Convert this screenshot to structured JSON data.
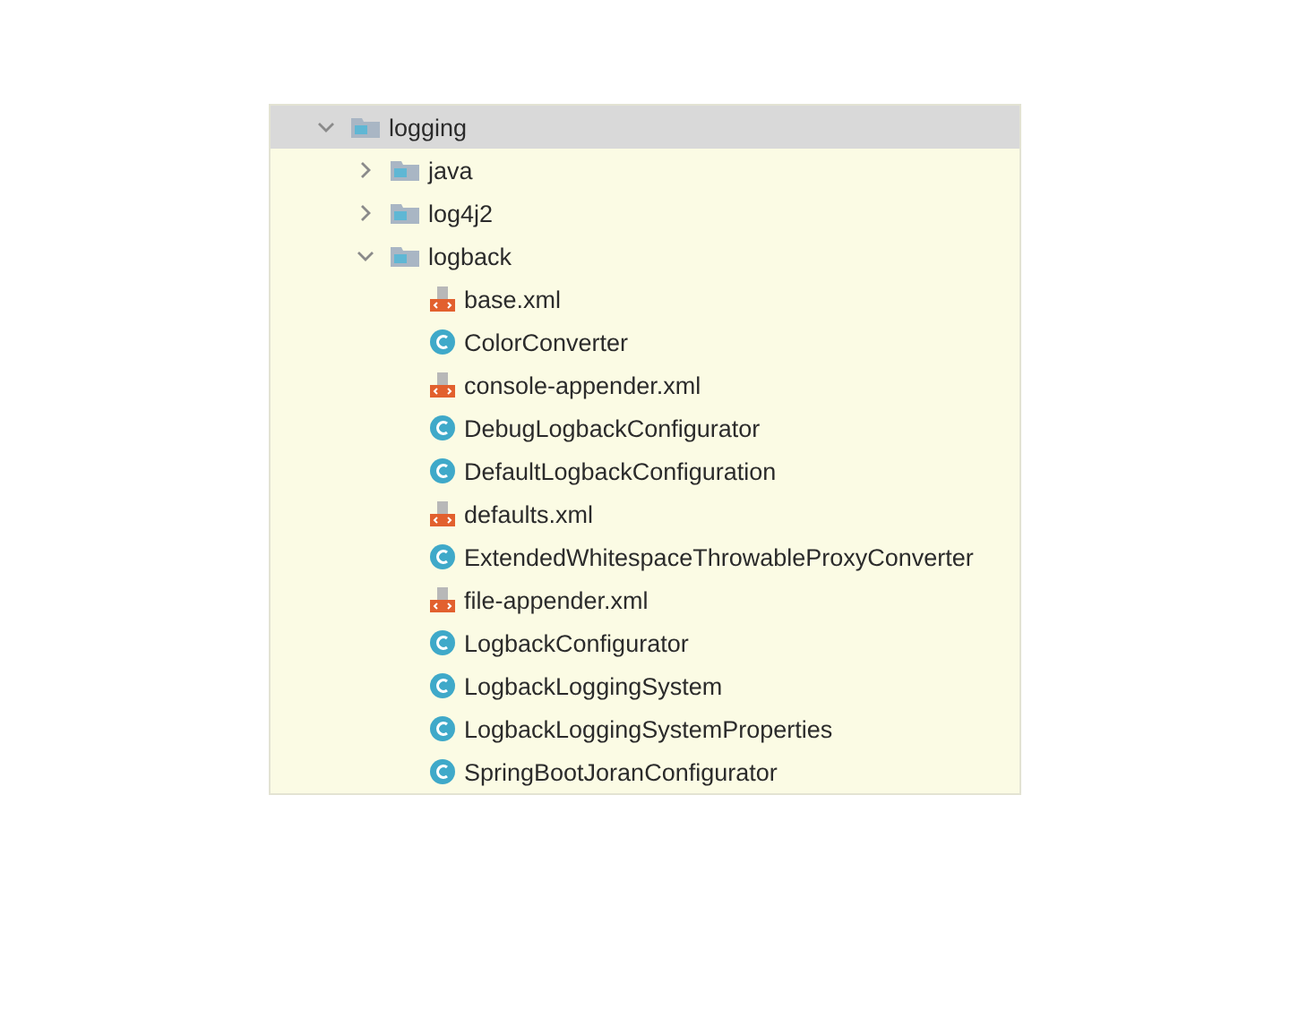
{
  "tree": [
    {
      "label": "logging",
      "kind": "folder",
      "expanded": true,
      "selected": true,
      "children": [
        {
          "label": "java",
          "kind": "folder",
          "expanded": false,
          "selected": false
        },
        {
          "label": "log4j2",
          "kind": "folder",
          "expanded": false,
          "selected": false
        },
        {
          "label": "logback",
          "kind": "folder",
          "expanded": true,
          "selected": false,
          "children": [
            {
              "label": "base.xml",
              "kind": "xml",
              "selected": false
            },
            {
              "label": "ColorConverter",
              "kind": "class",
              "selected": false
            },
            {
              "label": "console-appender.xml",
              "kind": "xml",
              "selected": false
            },
            {
              "label": "DebugLogbackConfigurator",
              "kind": "class",
              "selected": false
            },
            {
              "label": "DefaultLogbackConfiguration",
              "kind": "class",
              "selected": false
            },
            {
              "label": "defaults.xml",
              "kind": "xml",
              "selected": false
            },
            {
              "label": "ExtendedWhitespaceThrowableProxyConverter",
              "kind": "class",
              "selected": false
            },
            {
              "label": "file-appender.xml",
              "kind": "xml",
              "selected": false
            },
            {
              "label": "LogbackConfigurator",
              "kind": "class",
              "selected": false
            },
            {
              "label": "LogbackLoggingSystem",
              "kind": "class",
              "selected": false
            },
            {
              "label": "LogbackLoggingSystemProperties",
              "kind": "class",
              "selected": false
            },
            {
              "label": "SpringBootJoranConfigurator",
              "kind": "class",
              "selected": false
            }
          ]
        }
      ]
    }
  ]
}
